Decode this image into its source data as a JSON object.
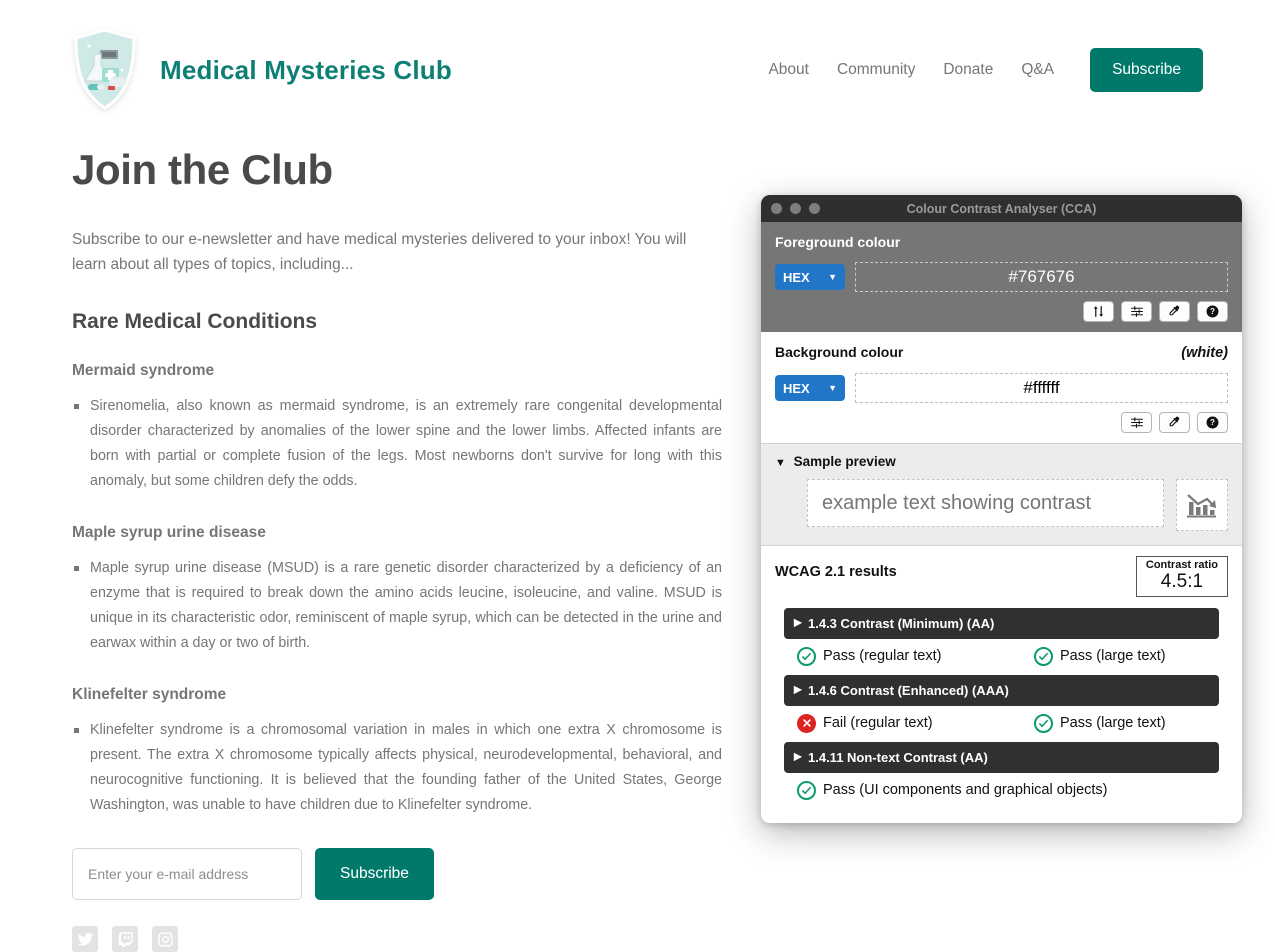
{
  "header": {
    "logo_icon": "medical-shield-logo",
    "brand": "Medical Mysteries Club",
    "nav": [
      {
        "label": "About"
      },
      {
        "label": "Community"
      },
      {
        "label": "Donate"
      },
      {
        "label": "Q&A"
      }
    ],
    "cta_label": "Subscribe",
    "cta_color": "#00796b",
    "brand_color": "#0d8075"
  },
  "main": {
    "title": "Join the Club",
    "lede": "Subscribe to our e-newsletter and have medical mysteries delivered to your inbox! You will learn about all types of topics, including...",
    "section_title": "Rare Medical Conditions",
    "conditions": [
      {
        "title": "Mermaid syndrome",
        "body": "Sirenomelia, also known as mermaid syndrome, is an extremely rare congenital developmental disorder characterized by anomalies of the lower spine and the lower limbs. Affected infants are born with partial or complete fusion of the legs. Most newborns don't survive for long with this anomaly, but some children defy the odds."
      },
      {
        "title": "Maple syrup urine disease",
        "body": "Maple syrup urine disease (MSUD) is a rare genetic disorder characterized by a deficiency of an enzyme that is required to break down the amino acids leucine, isoleucine, and valine. MSUD is unique in its characteristic odor, reminiscent of maple syrup, which can be detected in the urine and earwax within a day or two of birth."
      },
      {
        "title": "Klinefelter syndrome",
        "body": "Klinefelter syndrome is a chromosomal variation in males in which one extra X chromosome is present. The extra X chromosome typically affects physical, neurodevelopmental, behavioral, and neurocognitive functioning. It is believed that the founding father of the United States, George Washington, was unable to have children due to Klinefelter syndrome."
      }
    ],
    "form": {
      "email_placeholder": "Enter your e-mail address",
      "email_value": "",
      "submit_label": "Subscribe"
    },
    "social": [
      {
        "name": "twitter-icon"
      },
      {
        "name": "twitch-icon"
      },
      {
        "name": "instagram-icon"
      }
    ]
  },
  "cca": {
    "window_title": "Colour Contrast Analyser (CCA)",
    "foreground": {
      "heading": "Foreground colour",
      "format": "HEX",
      "value": "#767676",
      "buttons": [
        "swap-colours-icon",
        "sliders-icon",
        "eyedropper-icon",
        "help-icon"
      ]
    },
    "background": {
      "heading": "Background colour",
      "note": "(white)",
      "format": "HEX",
      "value": "#ffffff",
      "buttons": [
        "sliders-icon",
        "eyedropper-icon",
        "help-icon"
      ]
    },
    "sample": {
      "heading": "Sample preview",
      "text": "example text showing contrast",
      "graphic_icon": "chart-icon"
    },
    "results": {
      "heading": "WCAG 2.1 results",
      "ratio_label": "Contrast ratio",
      "ratio_value": "4.5:1",
      "criteria": [
        {
          "name": "1.4.3 Contrast (Minimum) (AA)",
          "outcomes": [
            {
              "status": "pass",
              "label": "Pass (regular text)"
            },
            {
              "status": "pass",
              "label": "Pass (large text)"
            }
          ]
        },
        {
          "name": "1.4.6 Contrast (Enhanced) (AAA)",
          "outcomes": [
            {
              "status": "fail",
              "label": "Fail (regular text)"
            },
            {
              "status": "pass",
              "label": "Pass (large text)"
            }
          ]
        },
        {
          "name": "1.4.11 Non-text Contrast (AA)",
          "outcomes": [
            {
              "status": "pass",
              "label": "Pass (UI components and graphical objects)"
            }
          ]
        }
      ]
    }
  }
}
